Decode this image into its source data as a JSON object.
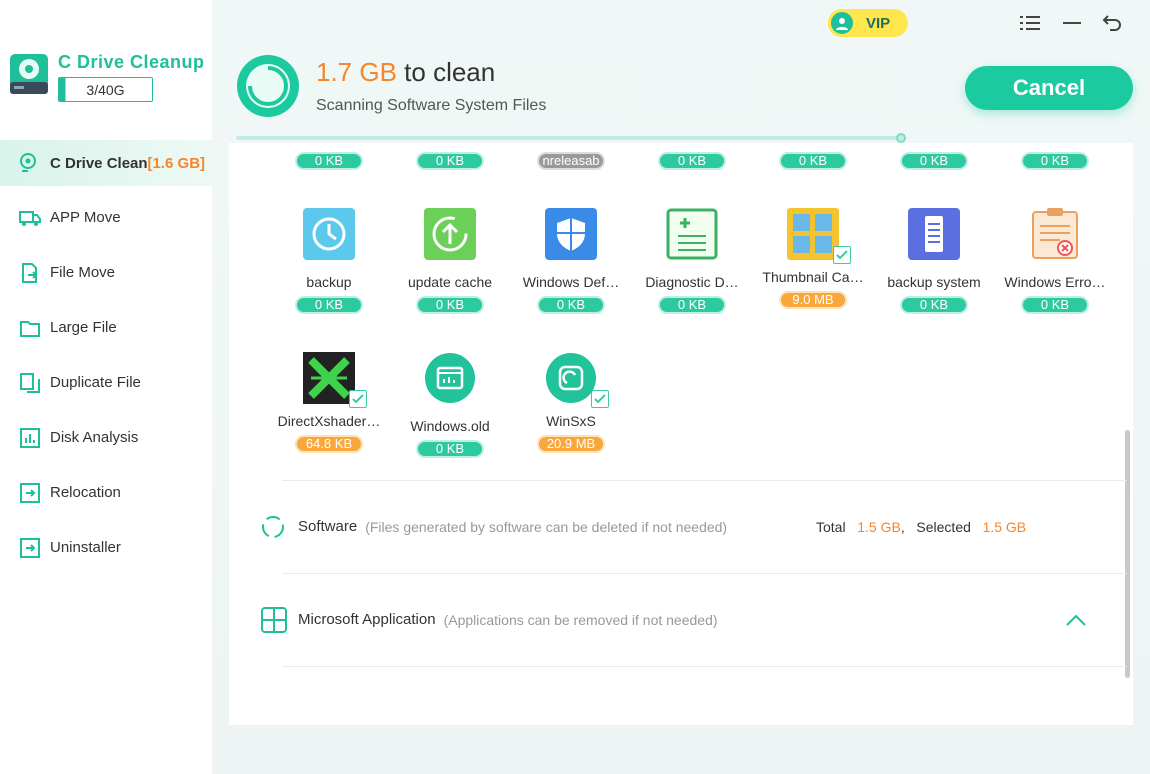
{
  "app": {
    "title": "C Drive Cleanup",
    "capacity": "3/40G",
    "accent": "#1fbf99",
    "orange": "#f5862c"
  },
  "topbar": {
    "vip": "VIP",
    "icons": [
      "user-icon",
      "menu-icon",
      "minimize-icon",
      "back-icon"
    ]
  },
  "sidebar": {
    "items": [
      {
        "label": "C Drive Clean",
        "badge": "[1.6 GB]",
        "icon": "broom-icon",
        "active": true
      },
      {
        "label": "APP Move",
        "icon": "truck-icon"
      },
      {
        "label": "File Move",
        "icon": "file-move-icon"
      },
      {
        "label": "Large File",
        "icon": "folder-icon"
      },
      {
        "label": "Duplicate File",
        "icon": "duplicate-icon"
      },
      {
        "label": "Disk Analysis",
        "icon": "chart-icon"
      },
      {
        "label": "Relocation",
        "icon": "relocation-icon"
      },
      {
        "label": "Uninstaller",
        "icon": "uninstall-icon"
      }
    ]
  },
  "header": {
    "size": "1.7 GB",
    "suffix": " to clean",
    "subtitle": "Scanning Software System Files",
    "cancel": "Cancel",
    "progress": 0.95
  },
  "tiles": {
    "row0": [
      {
        "size": "0 KB",
        "color": "green"
      },
      {
        "size": "0 KB",
        "color": "green"
      },
      {
        "size": "nreleasab",
        "color": "gray"
      },
      {
        "size": "0 KB",
        "color": "green"
      },
      {
        "size": "0 KB",
        "color": "green"
      },
      {
        "size": "0 KB",
        "color": "green"
      },
      {
        "size": "0 KB",
        "color": "green"
      }
    ],
    "row1": [
      {
        "name": "backup",
        "size": "0 KB",
        "icon": "clock-icon"
      },
      {
        "name": "update cache",
        "size": "0 KB",
        "icon": "update-icon"
      },
      {
        "name": "Windows Def…",
        "size": "0 KB",
        "icon": "shield-icon"
      },
      {
        "name": "Diagnostic D…",
        "size": "0 KB",
        "icon": "diagnostic-icon"
      },
      {
        "name": "Thumbnail Ca…",
        "size": "9.0 MB",
        "icon": "thumbnail-icon"
      },
      {
        "name": "backup system",
        "size": "0 KB",
        "icon": "phone-icon"
      },
      {
        "name": "Windows Erro…",
        "size": "0 KB",
        "icon": "error-report-icon"
      }
    ],
    "row2": [
      {
        "name": "DirectXshader…",
        "size": "64.8 KB",
        "icon": "directx-icon"
      },
      {
        "name": "Windows.old",
        "size": "0 KB",
        "icon": "windows-old-icon"
      },
      {
        "name": "WinSxS",
        "size": "20.9 MB",
        "icon": "winsxs-icon"
      }
    ]
  },
  "sections": [
    {
      "title": "Software",
      "desc": "(Files generated by software can be deleted if not needed)",
      "total_label": "Total",
      "total": "1.5 GB",
      "selected_label": "Selected",
      "selected": "1.5 GB"
    },
    {
      "title": "Microsoft Application",
      "desc": "(Applications can be removed if not needed)"
    }
  ]
}
